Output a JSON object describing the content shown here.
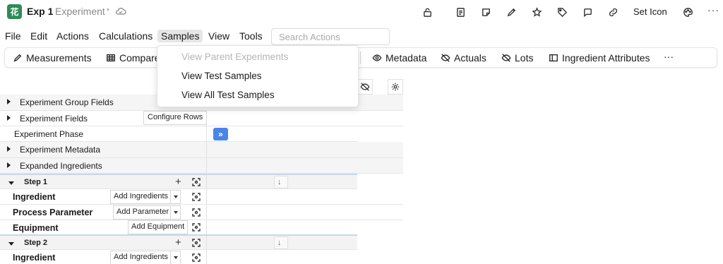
{
  "app": {
    "logo_text": "花",
    "exp_name": "Exp 1",
    "exp_type": "Experiment",
    "dot": "•",
    "set_icon_label": "Set Icon",
    "more": "···"
  },
  "menu": {
    "items": [
      "File",
      "Edit",
      "Actions",
      "Calculations",
      "Samples",
      "View",
      "Tools"
    ],
    "active": "Samples",
    "search_placeholder": "Search Actions"
  },
  "toolbar": {
    "measurements": "Measurements",
    "compare": "Compare",
    "metadata": "Metadata",
    "actuals": "Actuals",
    "lots": "Lots",
    "ingredient_attributes": "Ingredient Attributes",
    "more": "···"
  },
  "samples_menu": {
    "items": [
      {
        "label": "View Parent Experiments",
        "disabled": true
      },
      {
        "label": "View Test Samples",
        "disabled": false
      },
      {
        "label": "View All Test Samples",
        "disabled": false
      }
    ]
  },
  "grid": {
    "experiment_group_fields": "Experiment Group Fields",
    "experiment_fields": "Experiment Fields",
    "configure_rows": "Configure Rows",
    "experiment_phase": "Experiment Phase",
    "phase_button": "»",
    "experiment_metadata": "Experiment Metadata",
    "expanded_ingredients": "Expanded Ingredients",
    "step1": {
      "label": "Step 1",
      "ingredient": "Ingredient",
      "add_ingredients": "Add Ingredients",
      "process_parameter": "Process Parameter",
      "add_parameter": "Add Parameter",
      "equipment": "Equipment",
      "add_equipment": "Add Equipment"
    },
    "step2": {
      "label": "Step 2",
      "ingredient": "Ingredient",
      "add_ingredients": "Add Ingredients"
    },
    "plus": "+",
    "down_arrow": "↓"
  }
}
